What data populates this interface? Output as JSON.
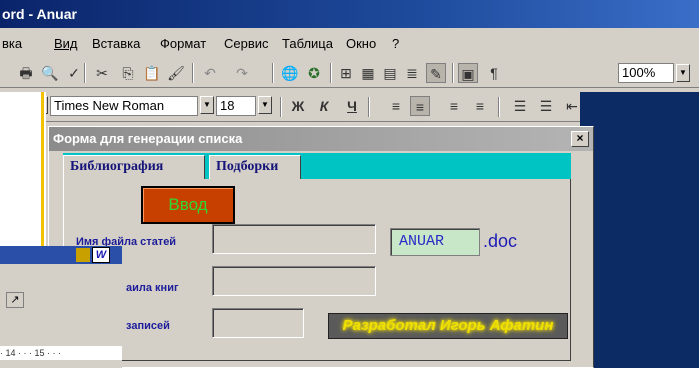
{
  "window": {
    "title": "ord - Anuar"
  },
  "menu": [
    "вка",
    "Вид",
    "Вставка",
    "Формат",
    "Сервис",
    "Таблица",
    "Окно",
    "?"
  ],
  "toolbar": {
    "zoom": "100%"
  },
  "format_toolbar": {
    "font": "Times New Roman",
    "size": "18",
    "bold": "Ж",
    "italic": "К",
    "underline": "Ч"
  },
  "form": {
    "title": "Форма для генерации списка",
    "close": "×",
    "tabs": [
      "Библиография",
      "Подборки"
    ],
    "input_button": "Ввод",
    "labels": {
      "articles": "Имя файла статей",
      "books": "аила книг",
      "records": "записей"
    },
    "filename": "ANUAR",
    "extension": ".doc",
    "developer": "Разработал Игорь Афатин"
  },
  "ruler": "· 14 · · · 15 · · ·",
  "icons": {
    "print": "print-icon",
    "preview": "preview-icon",
    "spell": "spell-icon",
    "cut": "cut-icon",
    "copy": "copy-icon",
    "paste": "paste-icon",
    "undo": "undo-icon",
    "redo": "redo-icon"
  }
}
